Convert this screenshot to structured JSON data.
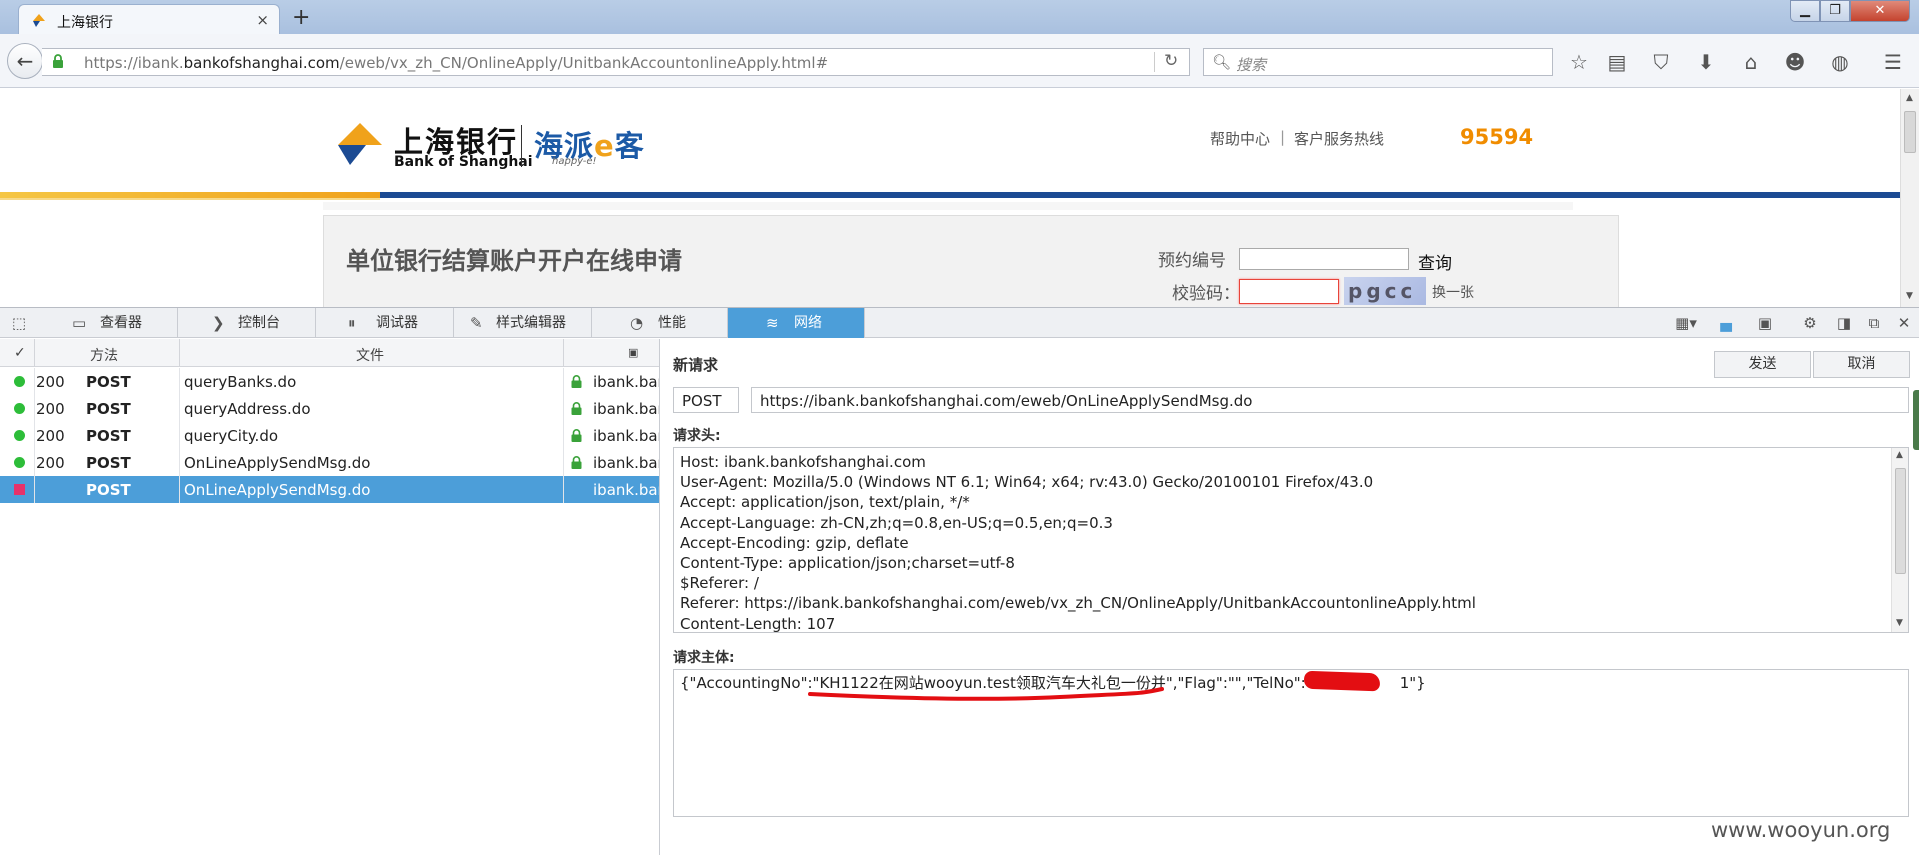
{
  "browser": {
    "tab_title": "上海银行",
    "url_prefix": "https://ibank.",
    "url_domain": "bankofshanghai.com",
    "url_path": "/eweb/vx_zh_CN/OnlineApply/UnitbankAccountonlineApply.html#",
    "search_placeholder": "搜索",
    "new_tab": "+",
    "tab_close": "×"
  },
  "page": {
    "logo_cn": "上海银行",
    "logo_en": "Bank of Shanghai",
    "logo_haipai": "海派",
    "logo_e": "e",
    "logo_ke": "客",
    "logo_sub": "happy-e!",
    "help_center": "帮助中心",
    "separator": "|",
    "hotline_label": "客户服务热线",
    "hotline_number": "95594",
    "apply_title": "单位银行结算账户开户在线申请",
    "reservation_label": "预约编号",
    "query_button": "查询",
    "code_label": "校验码：",
    "captcha_text": "pgcc",
    "swap_label": "换一张"
  },
  "devtools": {
    "tabs": [
      {
        "label": "查看器",
        "icon": "inspector-icon"
      },
      {
        "label": "控制台",
        "icon": "console-icon"
      },
      {
        "label": "调试器",
        "icon": "debugger-icon"
      },
      {
        "label": "样式编辑器",
        "icon": "style-editor-icon"
      },
      {
        "label": "性能",
        "icon": "performance-icon"
      },
      {
        "label": "网络",
        "icon": "network-icon"
      }
    ],
    "active_tab": "网络",
    "columns": {
      "check": "✓",
      "method": "方法",
      "file": "文件"
    },
    "requests": [
      {
        "status": "200",
        "method": "POST",
        "file": "queryBanks.do",
        "domain": "ibank.bar"
      },
      {
        "status": "200",
        "method": "POST",
        "file": "queryAddress.do",
        "domain": "ibank.bar"
      },
      {
        "status": "200",
        "method": "POST",
        "file": "queryCity.do",
        "domain": "ibank.bar"
      },
      {
        "status": "200",
        "method": "POST",
        "file": "OnLineApplySendMsg.do",
        "domain": "ibank.bar"
      },
      {
        "status": "",
        "method": "POST",
        "file": "OnLineApplySendMsg.do",
        "domain": "ibank.bar"
      }
    ],
    "editor": {
      "title": "新请求",
      "send": "发送",
      "cancel": "取消",
      "method": "POST",
      "url": "https://ibank.bankofshanghai.com/eweb/OnLineApplySendMsg.do",
      "headers_label": "请求头:",
      "headers": [
        "Host: ibank.bankofshanghai.com",
        "User-Agent: Mozilla/5.0 (Windows NT 6.1; Win64; x64; rv:43.0) Gecko/20100101 Firefox/43.0",
        "Accept: application/json, text/plain, */*",
        "Accept-Language: zh-CN,zh;q=0.8,en-US;q=0.5,en;q=0.3",
        "Accept-Encoding: gzip, deflate",
        "Content-Type: application/json;charset=utf-8",
        "$Referer: /",
        "Referer: https://ibank.bankofshanghai.com/eweb/vx_zh_CN/OnlineApply/UnitbankAccountonlineApply.html",
        "Content-Length: 107"
      ],
      "body_label": "请求主体:",
      "body_prefix": "{\"AccountingNo\":\"",
      "body_highlight": "KH1122在网站wooyun.test领取汽车大礼包一份并",
      "body_suffix": "\",\"Flag\":\"\",\"TelNo\":\"15",
      "body_end": "1\"}"
    }
  },
  "watermark": "www.wooyun.org",
  "colors": {
    "accent": "#4c9ed9",
    "ok": "#2dbd39",
    "pending": "#e6336b",
    "redact": "#e30e12",
    "hotline": "#f08c00"
  }
}
